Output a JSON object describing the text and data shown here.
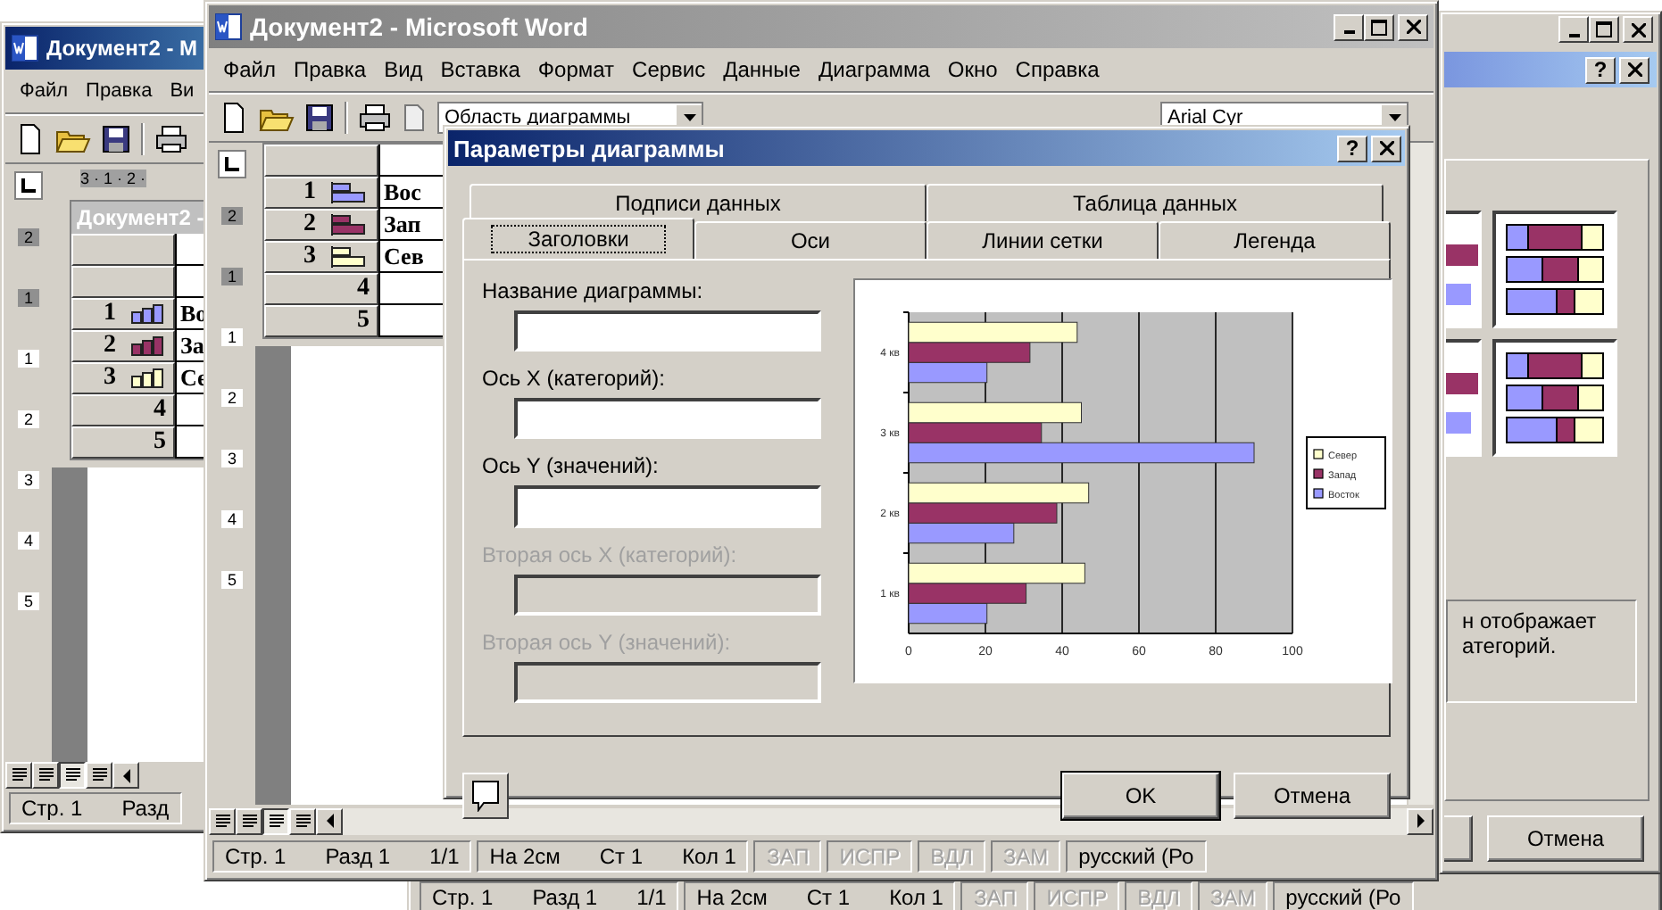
{
  "left_window": {
    "title": "Документ2 - М",
    "menu": [
      "Файл",
      "Правка",
      "Ви"
    ],
    "ruler": "3 · 1 · 2 ·",
    "ruler_marks": [
      "2",
      "1",
      "1",
      "2",
      "3",
      "4",
      "5"
    ],
    "inner_title": "Документ2 -",
    "rows": [
      {
        "number": "1",
        "text": "Во",
        "color": "#9999ff"
      },
      {
        "number": "2",
        "text": "За",
        "color": "#993366"
      },
      {
        "number": "3",
        "text": "Се",
        "color": "#ffffcc"
      },
      {
        "number": "4"
      },
      {
        "number": "5"
      }
    ],
    "status": [
      "Стр. 1",
      "Разд"
    ]
  },
  "main_window": {
    "title": "Документ2 - Microsoft Word",
    "menu": [
      "Файл",
      "Правка",
      "Вид",
      "Вставка",
      "Формат",
      "Сервис",
      "Данные",
      "Диаграмма",
      "Окно",
      "Справка"
    ],
    "object_box": "Область диаграммы",
    "font_box": "Arial Cyr",
    "ruler_marks": [
      "2",
      "1",
      "1",
      "2",
      "3",
      "4",
      "5"
    ],
    "rows": [
      {
        "number": "1",
        "text": "Вос",
        "color": "#9999ff"
      },
      {
        "number": "2",
        "text": "Зап",
        "color": "#993366"
      },
      {
        "number": "3",
        "text": "Сев",
        "color": "#ffffcc"
      },
      {
        "number": "4"
      },
      {
        "number": "5"
      }
    ],
    "status": [
      {
        "items": [
          "Стр. 1",
          "Разд 1",
          "1/1"
        ],
        "disabled": false
      },
      {
        "items": [
          "На 2см",
          "Ст 1",
          "Кол 1"
        ],
        "disabled": false
      },
      {
        "items": [
          "ЗАП"
        ],
        "disabled": true
      },
      {
        "items": [
          "ИСПР"
        ],
        "disabled": true
      },
      {
        "items": [
          "ВДЛ"
        ],
        "disabled": true
      },
      {
        "items": [
          "ЗАМ"
        ],
        "disabled": true
      },
      {
        "items": [
          "русский (Ро"
        ],
        "disabled": false
      }
    ]
  },
  "dialog": {
    "title": "Параметры диаграммы",
    "help_button": "?",
    "tab_rows": [
      {
        "tabs": [
          {
            "label": "Подписи данных",
            "selected": false
          },
          {
            "label": "Таблица данных",
            "selected": false
          }
        ]
      },
      {
        "tabs": [
          {
            "label": "Заголовки",
            "selected": true
          },
          {
            "label": "Оси",
            "selected": false
          },
          {
            "label": "Линии сетки",
            "selected": false
          },
          {
            "label": "Легенда",
            "selected": false
          }
        ]
      }
    ],
    "fields": [
      {
        "label": "Название диаграммы:",
        "disabled": false
      },
      {
        "label": "Ось X (категорий):",
        "disabled": false
      },
      {
        "label": "Ось Y (значений):",
        "disabled": false
      },
      {
        "label": "Вторая ось X (категорий):",
        "disabled": true
      },
      {
        "label": "Вторая ось Y (значений):",
        "disabled": true
      }
    ],
    "chart_data": {
      "type": "bar",
      "orientation": "horizontal",
      "categories": [
        "4 кв",
        "3 кв",
        "2 кв",
        "1 кв"
      ],
      "series": [
        {
          "name": "Восток",
          "color": "#9999ff",
          "values": [
            20.4,
            90,
            27.4,
            20.4
          ]
        },
        {
          "name": "Запад",
          "color": "#993366",
          "values": [
            31.6,
            34.6,
            38.6,
            30.6
          ]
        },
        {
          "name": "Север",
          "color": "#ffffcc",
          "values": [
            43.9,
            45,
            46.9,
            45.9
          ]
        }
      ],
      "xlim": [
        0,
        100
      ],
      "xticks": [
        0,
        20,
        40,
        60,
        80,
        100
      ],
      "grid": true,
      "legend": true
    },
    "buttons": [
      "OK",
      "Отмена"
    ]
  },
  "right_window": {
    "help_button": "?",
    "description": [
      "н отображает",
      "атегорий."
    ],
    "button": "Отмена"
  },
  "bottom_window": {
    "status": [
      {
        "items": [
          "Стр. 1",
          "Разд 1",
          "1/1"
        ],
        "disabled": false
      },
      {
        "items": [
          "На 2см",
          "Ст 1",
          "Кол 1"
        ],
        "disabled": false
      },
      {
        "items": [
          "ЗАП"
        ],
        "disabled": true
      },
      {
        "items": [
          "ИСПР"
        ],
        "disabled": true
      },
      {
        "items": [
          "ВДЛ"
        ],
        "disabled": true
      },
      {
        "items": [
          "ЗАМ"
        ],
        "disabled": true
      },
      {
        "items": [
          "русский (Ро"
        ],
        "disabled": false
      }
    ]
  }
}
